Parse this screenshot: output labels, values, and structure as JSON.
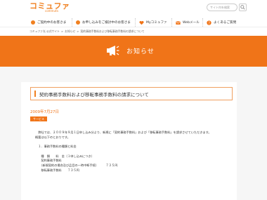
{
  "header": {
    "logo_text": "コミュファ",
    "logo_sub": "commufa",
    "search_placeholder": "サイト内を検索"
  },
  "colors": {
    "brand_orange": "#f07418",
    "panel_bg": "#f6f6f6"
  },
  "nav": {
    "items": [
      {
        "label": "ご契約中のお客さま",
        "icon": "orange-dot-icon"
      },
      {
        "label": "お申し込みをご検討中のお客さま",
        "icon": "orange-dot-icon"
      },
      {
        "label": "Myコミュファ",
        "icon": "heart-icon"
      },
      {
        "label": "Webメール",
        "icon": "mail-icon"
      },
      {
        "label": "よくあるご質問",
        "icon": "question-icon"
      }
    ]
  },
  "breadcrumb": {
    "items": [
      "コミュファ光 公式サイト",
      "お知らせ",
      "契約事務手数料および移転事務手数料の請求について"
    ]
  },
  "banner": {
    "title": "お知らせ"
  },
  "article": {
    "title": "契約事務手数料および移転事務手数料の請求について",
    "date": "2009年7月27日",
    "tag": "サービス",
    "body": "　弊社では、２００９年９月１日申し込み分より、新規に「契約事務手数料」および「移転事務手数料」を請求させていただきます。\n概要は以下のとおりです。\n\n　１．事務手数料の種類と料金\n\n　　種　類　　料　金（１申し込みにつき）\n　　契約事務手数料\n　　（新規契約の場合及び品目の一時中断手続）　　　７３５円\n　　移転事務手数料　　７３５円"
  }
}
